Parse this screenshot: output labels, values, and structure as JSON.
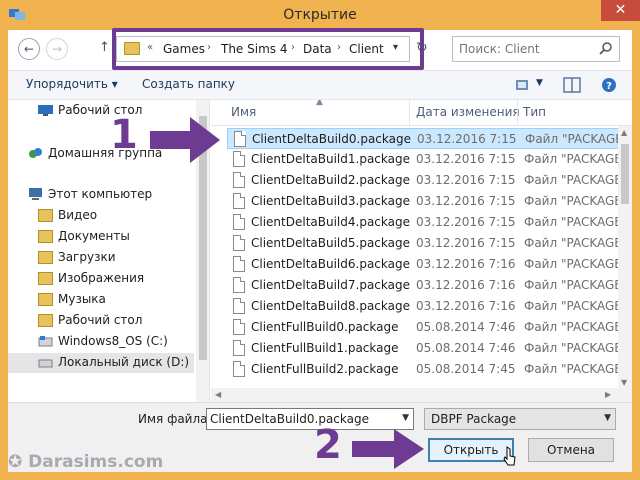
{
  "window": {
    "title": "Открытие",
    "close_label": "✕"
  },
  "address": {
    "overflow": "«",
    "segments": [
      "Games",
      "The Sims 4",
      "Data",
      "Client"
    ],
    "dropdown_glyph": "▾",
    "refresh_glyph": "↻"
  },
  "nav": {
    "back": "←",
    "forward": "→",
    "up": "↑"
  },
  "search": {
    "placeholder": "Поиск: Client"
  },
  "toolbar": {
    "organize_label": "Упорядочить ▾",
    "new_folder_label": "Создать папку"
  },
  "sidebar": {
    "items": [
      {
        "label": "Рабочий стол",
        "icon": "desktop-icon"
      },
      {
        "label": "Домашняя группа",
        "icon": "homegroup-icon"
      },
      {
        "label": "Этот компьютер",
        "icon": "computer-icon"
      },
      {
        "label": "Видео",
        "icon": "folder-icon"
      },
      {
        "label": "Документы",
        "icon": "folder-icon"
      },
      {
        "label": "Загрузки",
        "icon": "folder-icon"
      },
      {
        "label": "Изображения",
        "icon": "folder-icon"
      },
      {
        "label": "Музыка",
        "icon": "folder-icon"
      },
      {
        "label": "Рабочий стол",
        "icon": "folder-icon"
      },
      {
        "label": "Windows8_OS (C:)",
        "icon": "drive-icon"
      },
      {
        "label": "Локальный диск (D:)",
        "icon": "drive-icon"
      }
    ]
  },
  "files": {
    "columns": [
      "Имя",
      "Дата изменения",
      "Тип"
    ],
    "rows": [
      {
        "name": "ClientDeltaBuild0.package",
        "date": "03.12.2016 7:15",
        "type": "Файл \"PACKAGE\""
      },
      {
        "name": "ClientDeltaBuild1.package",
        "date": "03.12.2016 7:15",
        "type": "Файл \"PACKAGE\""
      },
      {
        "name": "ClientDeltaBuild2.package",
        "date": "03.12.2016 7:15",
        "type": "Файл \"PACKAGE\""
      },
      {
        "name": "ClientDeltaBuild3.package",
        "date": "03.12.2016 7:15",
        "type": "Файл \"PACKAGE\""
      },
      {
        "name": "ClientDeltaBuild4.package",
        "date": "03.12.2016 7:15",
        "type": "Файл \"PACKAGE\""
      },
      {
        "name": "ClientDeltaBuild5.package",
        "date": "03.12.2016 7:15",
        "type": "Файл \"PACKAGE\""
      },
      {
        "name": "ClientDeltaBuild6.package",
        "date": "03.12.2016 7:16",
        "type": "Файл \"PACKAGE\""
      },
      {
        "name": "ClientDeltaBuild7.package",
        "date": "03.12.2016 7:16",
        "type": "Файл \"PACKAGE\""
      },
      {
        "name": "ClientDeltaBuild8.package",
        "date": "03.12.2016 7:16",
        "type": "Файл \"PACKAGE\""
      },
      {
        "name": "ClientFullBuild0.package",
        "date": "05.08.2014 7:46",
        "type": "Файл \"PACKAGE\""
      },
      {
        "name": "ClientFullBuild1.package",
        "date": "05.08.2014 7:46",
        "type": "Файл \"PACKAGE\""
      },
      {
        "name": "ClientFullBuild2.package",
        "date": "05.08.2014 7:45",
        "type": "Файл \"PACKAGE\""
      }
    ]
  },
  "footer": {
    "filename_label": "Имя файла:",
    "filename_value": "ClientDeltaBuild0.package",
    "filetype_value": "DBPF Package",
    "open_label": "Открыть",
    "cancel_label": "Отмена"
  },
  "annotations": {
    "step1": "1",
    "step2": "2",
    "watermark": "✪ Darasims.com",
    "accent_color": "#6e3b93"
  }
}
